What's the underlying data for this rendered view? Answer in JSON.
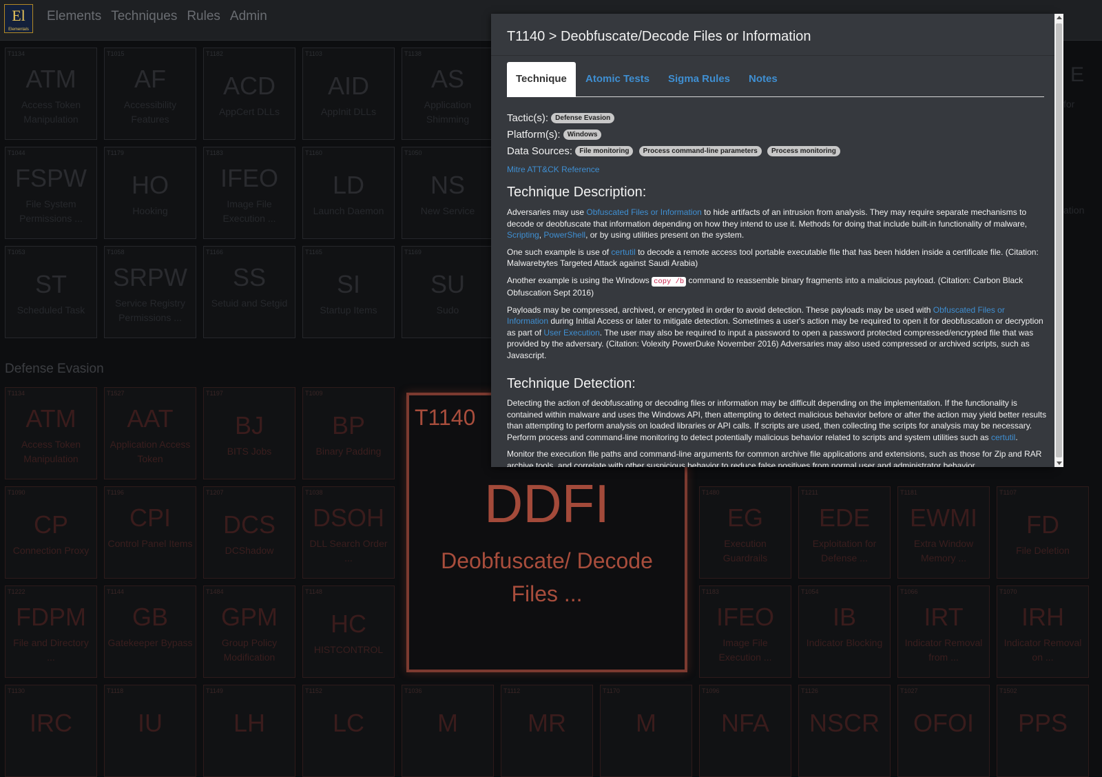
{
  "logo": {
    "symbol": "El",
    "subtitle": "Elementals"
  },
  "nav": {
    "items": [
      "Elements",
      "Techniques",
      "Rules",
      "Admin"
    ]
  },
  "grid": {
    "section_title": "Defense Evasion",
    "top_rows": [
      [
        {
          "id": "T1134",
          "abbr": "ATM",
          "name": "Access Token Manipulation"
        },
        {
          "id": "T1015",
          "abbr": "AF",
          "name": "Accessibility Features"
        },
        {
          "id": "T1182",
          "abbr": "ACD",
          "name": "AppCert DLLs"
        },
        {
          "id": "T1103",
          "abbr": "AID",
          "name": "AppInit DLLs"
        },
        {
          "id": "T1138",
          "abbr": "AS",
          "name": "Application Shimming"
        }
      ],
      [
        {
          "id": "T1044",
          "abbr": "FSPW",
          "name": "File System Permissions ..."
        },
        {
          "id": "T1179",
          "abbr": "HO",
          "name": "Hooking"
        },
        {
          "id": "T1183",
          "abbr": "IFEO",
          "name": "Image File Execution ..."
        },
        {
          "id": "T1160",
          "abbr": "LD",
          "name": "Launch Daemon"
        },
        {
          "id": "T1050",
          "abbr": "NS",
          "name": "New Service"
        }
      ],
      [
        {
          "id": "T1053",
          "abbr": "ST",
          "name": "Scheduled Task"
        },
        {
          "id": "T1058",
          "abbr": "SRPW",
          "name": "Service Registry Permissions ..."
        },
        {
          "id": "T1166",
          "abbr": "SS",
          "name": "Setuid and Setgid"
        },
        {
          "id": "T1165",
          "abbr": "SI",
          "name": "Startup Items"
        },
        {
          "id": "T1169",
          "abbr": "SU",
          "name": "Sudo"
        }
      ]
    ],
    "de_row1": [
      {
        "id": "T1134",
        "abbr": "ATM",
        "name": "Access Token Manipulation"
      },
      {
        "id": "T1527",
        "abbr": "AAT",
        "name": "Application Access Token"
      },
      {
        "id": "T1197",
        "abbr": "BJ",
        "name": "BITS Jobs"
      },
      {
        "id": "T1009",
        "abbr": "BP",
        "name": "Binary Padding"
      }
    ],
    "de_row2_left": [
      {
        "id": "T1090",
        "abbr": "CP",
        "name": "Connection Proxy"
      },
      {
        "id": "T1196",
        "abbr": "CPI",
        "name": "Control Panel Items"
      },
      {
        "id": "T1207",
        "abbr": "DCS",
        "name": "DCShadow"
      },
      {
        "id": "T1038",
        "abbr": "DSOH",
        "name": "DLL Search Order ..."
      }
    ],
    "de_row2_right": [
      {
        "id": "T1480",
        "abbr": "EG",
        "name": "Execution Guardrails"
      },
      {
        "id": "T1211",
        "abbr": "EDE",
        "name": "Exploitation for Defense ..."
      },
      {
        "id": "T1181",
        "abbr": "EWMI",
        "name": "Extra Window Memory ..."
      },
      {
        "id": "T1107",
        "abbr": "FD",
        "name": "File Deletion"
      }
    ],
    "de_row3_left": [
      {
        "id": "T1222",
        "abbr": "FDPM",
        "name": "File and Directory ..."
      },
      {
        "id": "T1144",
        "abbr": "GB",
        "name": "Gatekeeper Bypass"
      },
      {
        "id": "T1484",
        "abbr": "GPM",
        "name": "Group Policy Modification"
      },
      {
        "id": "T1148",
        "abbr": "HC",
        "name": "HISTCONTROL"
      }
    ],
    "de_row3_right": [
      {
        "id": "T1183",
        "abbr": "IFEO",
        "name": "Image File Execution ..."
      },
      {
        "id": "T1054",
        "abbr": "IB",
        "name": "Indicator Blocking"
      },
      {
        "id": "T1066",
        "abbr": "IRT",
        "name": "Indicator Removal from ..."
      },
      {
        "id": "T1070",
        "abbr": "IRH",
        "name": "Indicator Removal on ..."
      }
    ],
    "de_row4": [
      {
        "id": "T1130",
        "abbr": "IRC",
        "name": ""
      },
      {
        "id": "T1118",
        "abbr": "IU",
        "name": ""
      },
      {
        "id": "T1149",
        "abbr": "LH",
        "name": ""
      },
      {
        "id": "T1152",
        "abbr": "LC",
        "name": ""
      },
      {
        "id": "T1036",
        "abbr": "M",
        "name": ""
      },
      {
        "id": "T1112",
        "abbr": "MR",
        "name": ""
      },
      {
        "id": "T1170",
        "abbr": "M",
        "name": ""
      },
      {
        "id": "T1096",
        "abbr": "NFA",
        "name": ""
      },
      {
        "id": "T1126",
        "abbr": "NSCR",
        "name": ""
      },
      {
        "id": "T1027",
        "abbr": "OFOI",
        "name": ""
      },
      {
        "id": "T1502",
        "abbr": "PPS",
        "name": ""
      }
    ],
    "edge_fragments": [
      "E",
      "for",
      "ation"
    ]
  },
  "featured": {
    "id": "T1140",
    "abbr": "DDFI",
    "name": "Deobfuscate/ Decode Files ..."
  },
  "modal": {
    "title": "T1140 > Deobfuscate/Decode Files or Information",
    "tabs": [
      "Technique",
      "Atomic Tests",
      "Sigma Rules",
      "Notes"
    ],
    "tactics_label": "Tactic(s):",
    "tactics": [
      "Defense Evasion"
    ],
    "platforms_label": "Platform(s):",
    "platforms": [
      "Windows"
    ],
    "data_sources_label": "Data Sources:",
    "data_sources": [
      "File monitoring",
      "Process command-line parameters",
      "Process monitoring"
    ],
    "reference_link": "Mitre ATT&CK Reference",
    "description_heading": "Technique Description:",
    "desc": {
      "p1a": "Adversaries may use ",
      "p1_link1": "Obfuscated Files or Information",
      "p1b": " to hide artifacts of an intrusion from analysis. They may require separate mechanisms to decode or deobfuscate that information depending on how they intend to use it. Methods for doing that include built-in functionality of malware, ",
      "p1_link2": "Scripting",
      "p1c": ", ",
      "p1_link3": "PowerShell",
      "p1d": ", or by using utilities present on the system.",
      "p2a": "One such example is use of ",
      "p2_link": "certutil",
      "p2b": " to decode a remote access tool portable executable file that has been hidden inside a certificate file. (Citation: Malwarebytes Targeted Attack against Saudi Arabia)",
      "p3a": "Another example is using the Windows ",
      "p3_code": "copy /b",
      "p3b": " command to reassemble binary fragments into a malicious payload. (Citation: Carbon Black Obfuscation Sept 2016)",
      "p4a": "Payloads may be compressed, archived, or encrypted in order to avoid detection. These payloads may be used with ",
      "p4_link1": "Obfuscated Files or Information",
      "p4b": " during Initial Access or later to mitigate detection. Sometimes a user's action may be required to open it for deobfuscation or decryption as part of ",
      "p4_link2": "User Execution",
      "p4c": ". The user may also be required to input a password to open a password protected compressed/encrypted file that was provided by the adversary. (Citation: Volexity PowerDuke November 2016) Adversaries may also used compressed or archived scripts, such as Javascript."
    },
    "detection_heading": "Technique Detection:",
    "det": {
      "p1a": "Detecting the action of deobfuscating or decoding files or information may be difficult depending on the implementation. If the functionality is contained within malware and uses the Windows API, then attempting to detect malicious behavior before or after the action may yield better results than attempting to perform analysis on loaded libraries or API calls. If scripts are used, then collecting the scripts for analysis may be necessary. Perform process and command-line monitoring to detect potentially malicious behavior related to scripts and system utilities such as ",
      "p1_link": "certutil",
      "p1b": ".",
      "p2": "Monitor the execution file paths and command-line arguments for common archive file applications and extensions, such as those for Zip and RAR archive tools, and correlate with other suspicious behavior to reduce false positives from normal user and administrator behavior."
    }
  }
}
